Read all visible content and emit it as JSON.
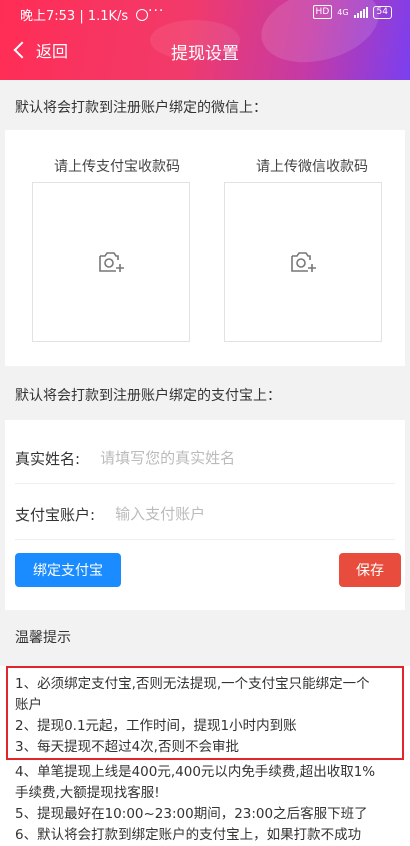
{
  "status_bar": {
    "time": "晚上7:53 | 1.1K/s",
    "alarm_icon": "alarm-icon",
    "more": "···",
    "hd": "HD",
    "network": "4G",
    "battery": "54"
  },
  "nav": {
    "back_label": "返回",
    "title": "提现设置"
  },
  "wechat_section": {
    "label": "默认将会打款到注册账户绑定的微信上：",
    "alipay_upload_label": "请上传支付宝收款码",
    "wechat_upload_label": "请上传微信收款码",
    "upload_icon": "camera-plus-icon"
  },
  "alipay_section": {
    "label": "默认将会打款到注册账户绑定的支付宝上：",
    "name_label": "真实姓名:",
    "name_placeholder": "请填写您的真实姓名",
    "account_label": "支付宝账户:",
    "account_placeholder": "输入支付账户",
    "bind_button": "绑定支付宝",
    "save_button": "保存"
  },
  "tips": {
    "title": "温馨提示",
    "items": [
      "1、必须绑定支付宝,否则无法提现,一个支付宝只能绑定一个",
      "账户",
      "2、提现0.1元起，工作时间，提现1小时内到账",
      "3、每天提现不超过4次,否则不会审批",
      "4、单笔提现上线是400元,400元以内免手续费,超出收取1%",
      "手续费,大额提现找客服!",
      "5、提现最好在10:00~23:00期间，23:00之后客服下班了",
      "6、默认将会打款到绑定账户的支付宝上，如果打款不成功"
    ]
  },
  "colors": {
    "bind_button": "#1a8cff",
    "save_button": "#e74c3c",
    "highlight_border": "#e0252b"
  }
}
